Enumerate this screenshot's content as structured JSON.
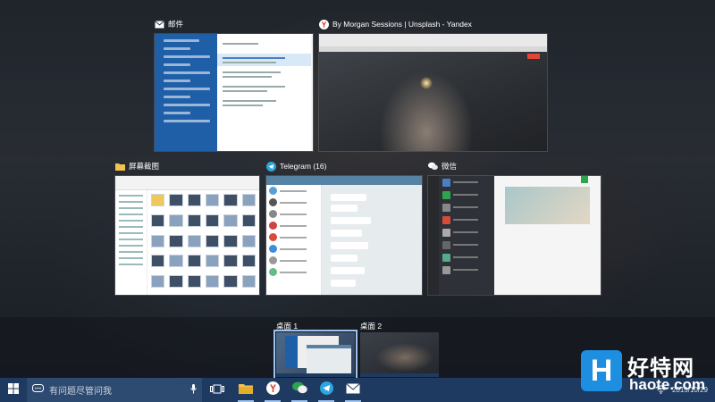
{
  "task_view": {
    "windows": [
      {
        "id": "mail",
        "title": "邮件",
        "icon": "mail-icon"
      },
      {
        "id": "yandex",
        "title": "By Morgan Sessions | Unsplash - Yandex",
        "icon": "yandex-icon"
      },
      {
        "id": "explorer",
        "title": "屏幕截图",
        "icon": "folder-icon"
      },
      {
        "id": "telegram",
        "title": "Telegram (16)",
        "icon": "telegram-icon"
      },
      {
        "id": "wechat",
        "title": "微信",
        "icon": "wechat-icon"
      }
    ],
    "desktops": [
      {
        "label": "桌面 1",
        "active": true
      },
      {
        "label": "桌面 2",
        "active": false
      }
    ]
  },
  "taskbar": {
    "search_placeholder": "有问题尽管问我",
    "apps": [
      {
        "name": "file-explorer",
        "icon": "folder-icon",
        "running": true
      },
      {
        "name": "yandex",
        "icon": "yandex-icon",
        "running": true
      },
      {
        "name": "wechat",
        "icon": "wechat-icon",
        "running": true
      },
      {
        "name": "telegram",
        "icon": "telegram-icon",
        "running": true
      },
      {
        "name": "mail",
        "icon": "mail-icon",
        "running": true
      }
    ],
    "clock": {
      "date": "2015/10/29"
    }
  },
  "watermark": {
    "cn": "好特网",
    "url": "haote.com",
    "logo_char": "H"
  },
  "colors": {
    "taskbar": "#1e3a60",
    "accent": "#9ec3ee",
    "yandex_red": "#e0453a",
    "telegram_blue": "#2ca5e0",
    "wechat_green": "#2ea44f"
  }
}
